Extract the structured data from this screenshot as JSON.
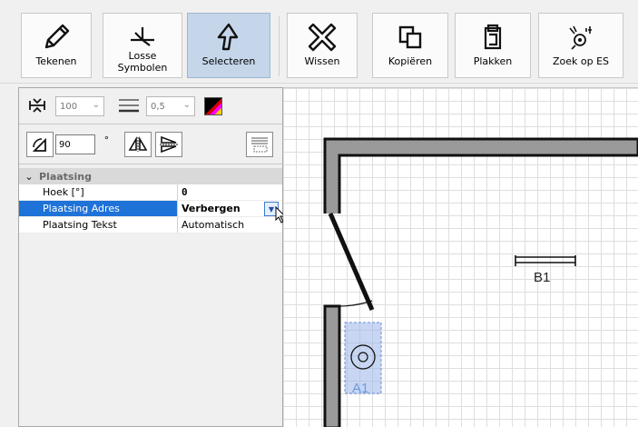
{
  "toolbar": {
    "buttons": [
      {
        "id": "draw",
        "label": "Tekenen",
        "icon": "pencil-icon"
      },
      {
        "id": "symbols",
        "label_line1": "Losse",
        "label_line2": "Symbolen",
        "icon": "symbol-icon"
      },
      {
        "id": "select",
        "label": "Selecteren",
        "icon": "cursor-arrow-icon",
        "active": true
      },
      {
        "id": "delete",
        "label": "Wissen",
        "icon": "delete-x-icon"
      },
      {
        "id": "copy",
        "label": "Kopiëren",
        "icon": "copy-icon"
      },
      {
        "id": "paste",
        "label": "Plakken",
        "icon": "paste-icon"
      },
      {
        "id": "search",
        "label": "Zoek op ES",
        "icon": "search-es-icon"
      }
    ]
  },
  "panel": {
    "scale_value": "100",
    "line_width_value": "0,5",
    "rotation_value": "90",
    "degree_symbol": "°"
  },
  "properties": {
    "category": "Plaatsing",
    "rows": [
      {
        "key": "Hoek [°]",
        "value": "0"
      },
      {
        "key": "Plaatsing Adres",
        "value": "Verbergen"
      },
      {
        "key": "Plaatsing Tekst",
        "value": "Automatisch"
      }
    ]
  },
  "canvas": {
    "label_a1": "A1",
    "label_b1": "B1"
  },
  "colors": {
    "active_button": "#c5d6ea",
    "selection": "#1e72d8",
    "selected_symbol": "#6a9ae0"
  }
}
